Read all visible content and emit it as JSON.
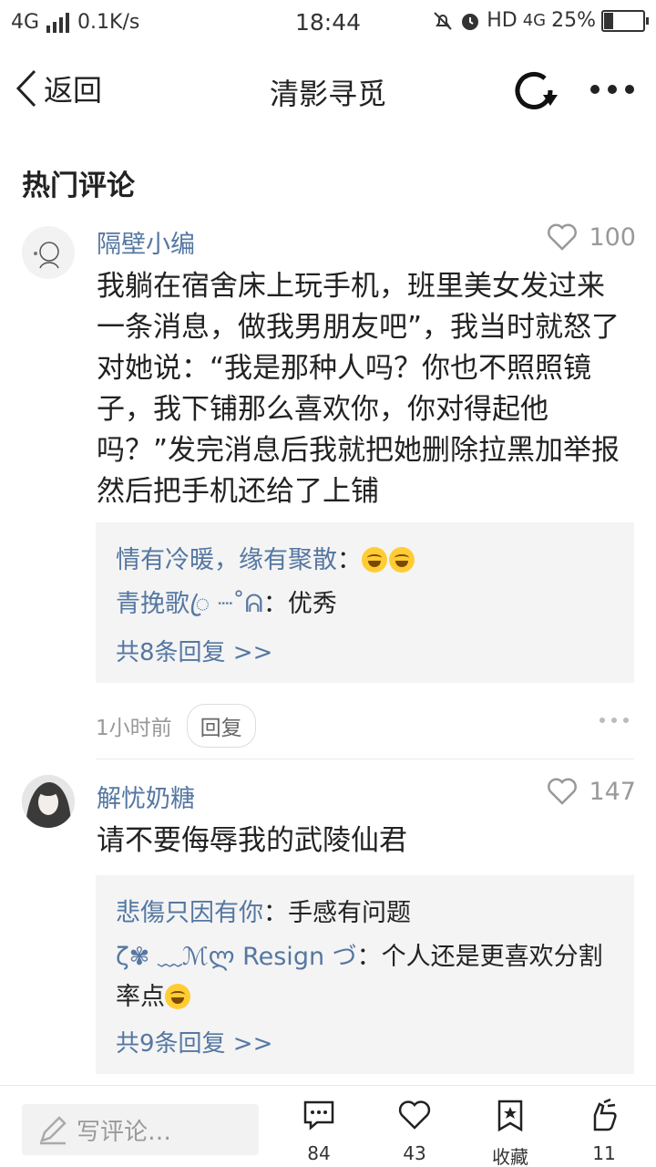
{
  "status_bar": {
    "network": "4G",
    "speed": "0.1K/s",
    "time": "18:44",
    "hd": "HD",
    "net2": "4G",
    "battery": "25%",
    "battery_level": 0.25
  },
  "header": {
    "back_label": "返回",
    "title": "清影寻觅"
  },
  "section_title": "热门评论",
  "comments": [
    {
      "user": "隔壁小编",
      "likes": "100",
      "text": "我躺在宿舍床上玩手机，班里美女发过来一条消息，做我男朋友吧”，我当时就怒了对她说：“我是那种人吗？你也不照照镜子，我下铺那么喜欢你，你对得起他吗？”发完消息后我就把她删除拉黑加举报然后把手机还给了上铺",
      "replies": [
        {
          "name": "情有冷暖，缘有聚散",
          "sep": "：",
          "text": ""
        },
        {
          "name": "青挽歌ꦿ ┈˚ᕱ",
          "sep": "：",
          "text": "优秀"
        }
      ],
      "see_all": "共8条回复 >>",
      "time": "1小时前",
      "reply_label": "回复"
    },
    {
      "user": "解忧奶糖",
      "likes": "147",
      "text": "请不要侮辱我的武陵仙君",
      "replies": [
        {
          "name": "悲傷只因有你",
          "sep": "：",
          "text": "手感有问题"
        },
        {
          "name": "ζ✾ ﹏ℳლ Resign づ",
          "sep": "：",
          "text": "个人还是更喜欢分割率点"
        }
      ],
      "see_all": "共9条回复 >>"
    }
  ],
  "bottom_bar": {
    "write_placeholder": "写评论…",
    "comments_count": "84",
    "likes_count": "43",
    "favorite_label": "收藏",
    "share_count": "11"
  }
}
